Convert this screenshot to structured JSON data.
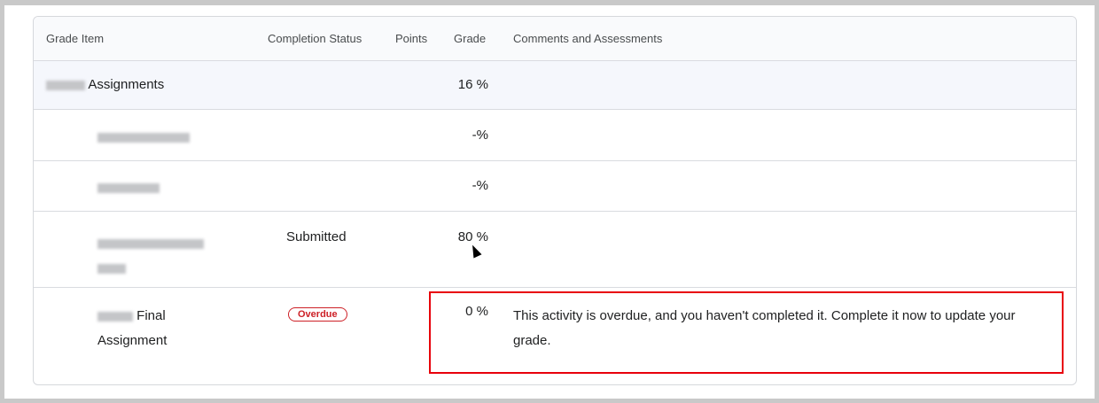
{
  "table": {
    "headers": [
      "Grade Item",
      "Completion Status",
      "Points",
      "Grade",
      "Comments and Assessments"
    ],
    "category": {
      "name": "Assignments",
      "grade": "16 %"
    },
    "rows": [
      {
        "name": "",
        "status": "",
        "grade": "-%",
        "comment": ""
      },
      {
        "name": "",
        "status": "",
        "grade": "-%",
        "comment": ""
      },
      {
        "name": "",
        "status": "Submitted",
        "grade": "80 %",
        "comment": ""
      },
      {
        "name": "Final Assignment",
        "status": "Overdue",
        "grade": "0 %",
        "comment": "This activity is overdue, and you haven't completed it. Complete it now to update your grade."
      }
    ]
  },
  "colors": {
    "overdue": "#cd2026",
    "highlight": "#e8000b"
  }
}
